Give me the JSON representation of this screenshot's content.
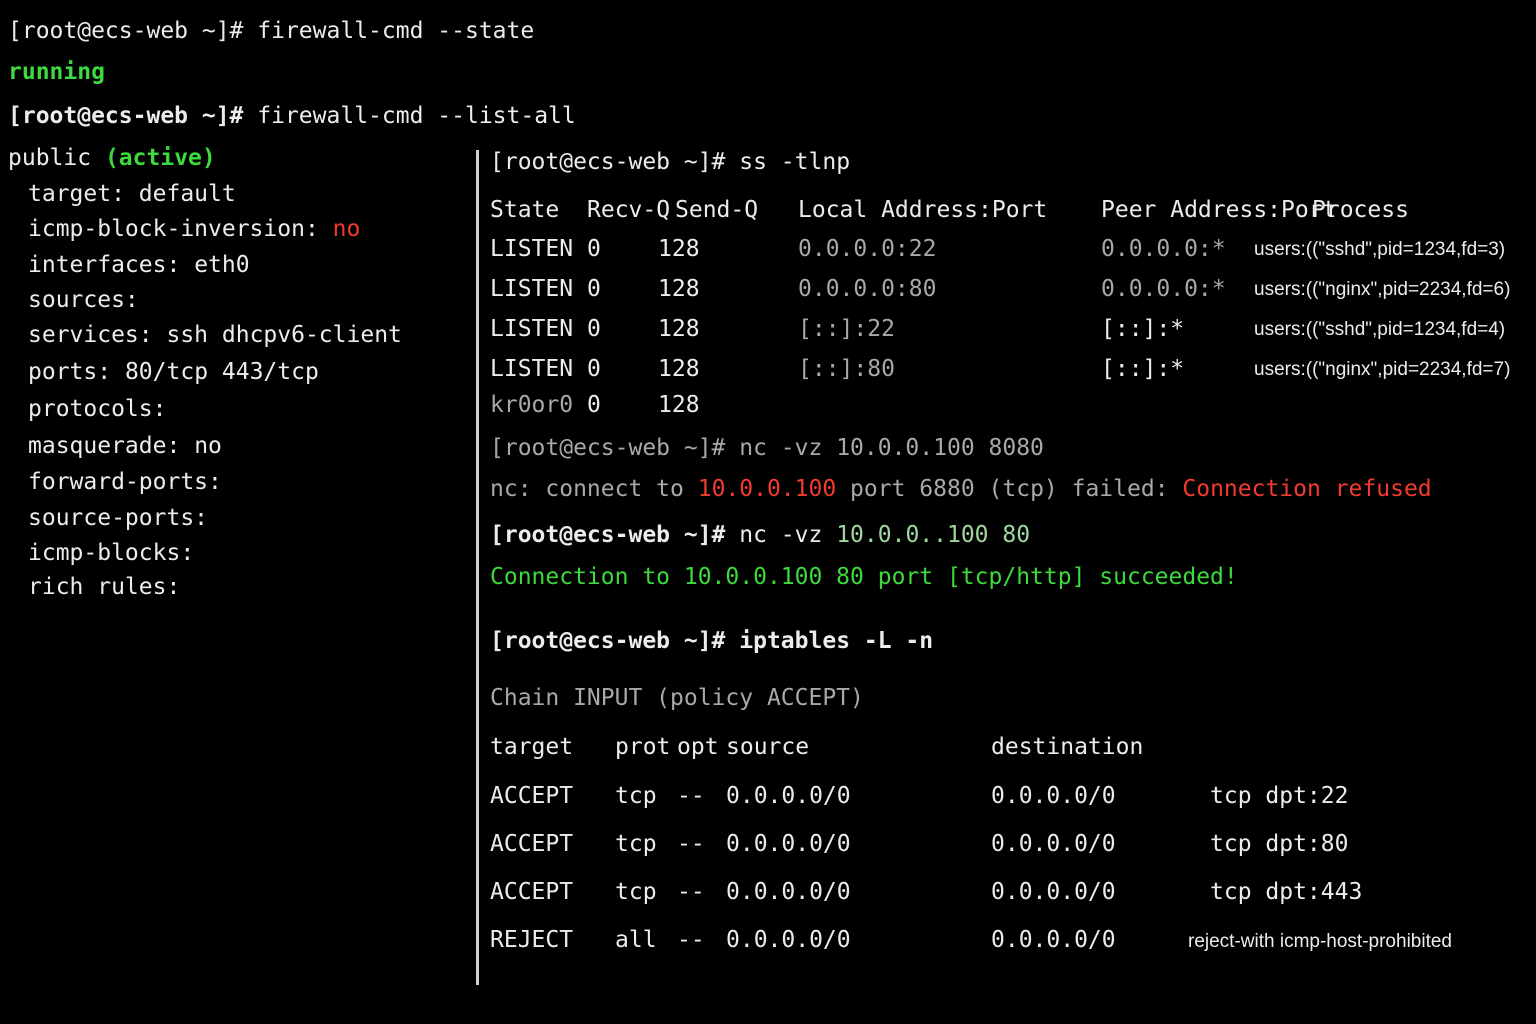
{
  "colors": {
    "background": "#000000",
    "text": "#ececec",
    "dim": "#a8a8a8",
    "success": "#3dd93d",
    "error": "#f23b2f"
  },
  "left": {
    "cmd1": {
      "prompt": "[root@ecs-web ~]#",
      "command": "firewall-cmd --state"
    },
    "state_output": "running",
    "cmd2": {
      "prompt": "[root@ecs-web ~]#",
      "command": "firewall-cmd --list-all"
    },
    "zone": {
      "name": "public",
      "status": "(active)"
    },
    "settings": [
      {
        "key": "target:",
        "value": "default"
      },
      {
        "key": "icmp-block-inversion:",
        "value": "no"
      },
      {
        "key": "interfaces:",
        "value": "eth0"
      },
      {
        "key": "sources:",
        "value": ""
      },
      {
        "key": "services:",
        "value": "ssh dhcpv6-client"
      },
      {
        "key": "ports:",
        "value": "80/tcp 443/tcp"
      },
      {
        "key": "protocols:",
        "value": ""
      },
      {
        "key": "masquerade:",
        "value": "no"
      },
      {
        "key": "forward-ports:",
        "value": ""
      },
      {
        "key": "source-ports:",
        "value": ""
      },
      {
        "key": "icmp-blocks:",
        "value": ""
      },
      {
        "key": "rich rules:",
        "value": ""
      }
    ]
  },
  "ss": {
    "prompt": "[root@ecs-web ~]#",
    "command": "ss -tlnp",
    "headers": {
      "state": "State",
      "recvq": "Recv-Q",
      "sendq": "Send-Q",
      "local": "Local Address:Port",
      "peer": "Peer Address:Port",
      "process": "Process"
    },
    "rows": [
      {
        "state": "LISTEN",
        "recvq": "0",
        "sendq": "128",
        "local": "0.0.0.0:22",
        "peer": "0.0.0.0:*",
        "process": "users:((\"sshd\",pid=1234,fd=3)"
      },
      {
        "state": "LISTEN",
        "recvq": "0",
        "sendq": "128",
        "local": "0.0.0.0:80",
        "peer": "0.0.0.0:*",
        "process": "users:((\"nginx\",pid=2234,fd=6)"
      },
      {
        "state": "LISTEN",
        "recvq": "0",
        "sendq": "128",
        "local": "[::]:22",
        "peer": "[::]:*",
        "process": "users:((\"sshd\",pid=1234,fd=4)"
      },
      {
        "state": "LISTEN",
        "recvq": "0",
        "sendq": "128",
        "local": "[::]:80",
        "peer": "[::]:*",
        "process": "users:((\"nginx\",pid=2234,fd=7)"
      },
      {
        "state": "kr0or0",
        "recvq": "0",
        "sendq": "128",
        "local": "",
        "peer": "",
        "process": ""
      }
    ]
  },
  "nc1": {
    "prompt": "[root@ecs-web ~]#",
    "command": "nc -vz 10.0.0.100 8080",
    "output_pre": "nc: connect to ",
    "output_ip": "10.0.0.100",
    "output_mid": " port 6880 (tcp) failed: ",
    "output_error": "Connection refused"
  },
  "nc2": {
    "prompt": "[root@ecs-web ~]#",
    "command_pre": "nc -vz ",
    "command_target": "10.0.0..100 80",
    "output": "Connection to 10.0.0.100 80 port [tcp/http] succeeded!"
  },
  "iptables": {
    "prompt": "[root@ecs-web ~]#",
    "command": "iptables -L -n",
    "chain": "Chain INPUT (policy ACCEPT)",
    "headers": {
      "target": "target",
      "prot": "prot",
      "opt": "opt",
      "source": "source",
      "destination": "destination"
    },
    "rows": [
      {
        "target": "ACCEPT",
        "prot": "tcp",
        "opt": "--",
        "source": "0.0.0.0/0",
        "destination": "0.0.0.0/0",
        "extra": "tcp dpt:22"
      },
      {
        "target": "ACCEPT",
        "prot": "tcp",
        "opt": "--",
        "source": "0.0.0.0/0",
        "destination": "0.0.0.0/0",
        "extra": "tcp dpt:80"
      },
      {
        "target": "ACCEPT",
        "prot": "tcp",
        "opt": "--",
        "source": "0.0.0.0/0",
        "destination": "0.0.0.0/0",
        "extra": "tcp dpt:443"
      },
      {
        "target": "REJECT",
        "prot": "all",
        "opt": "--",
        "source": "0.0.0.0/0",
        "destination": "0.0.0.0/0",
        "extra": "reject-with icmp-host-prohibited"
      }
    ]
  }
}
